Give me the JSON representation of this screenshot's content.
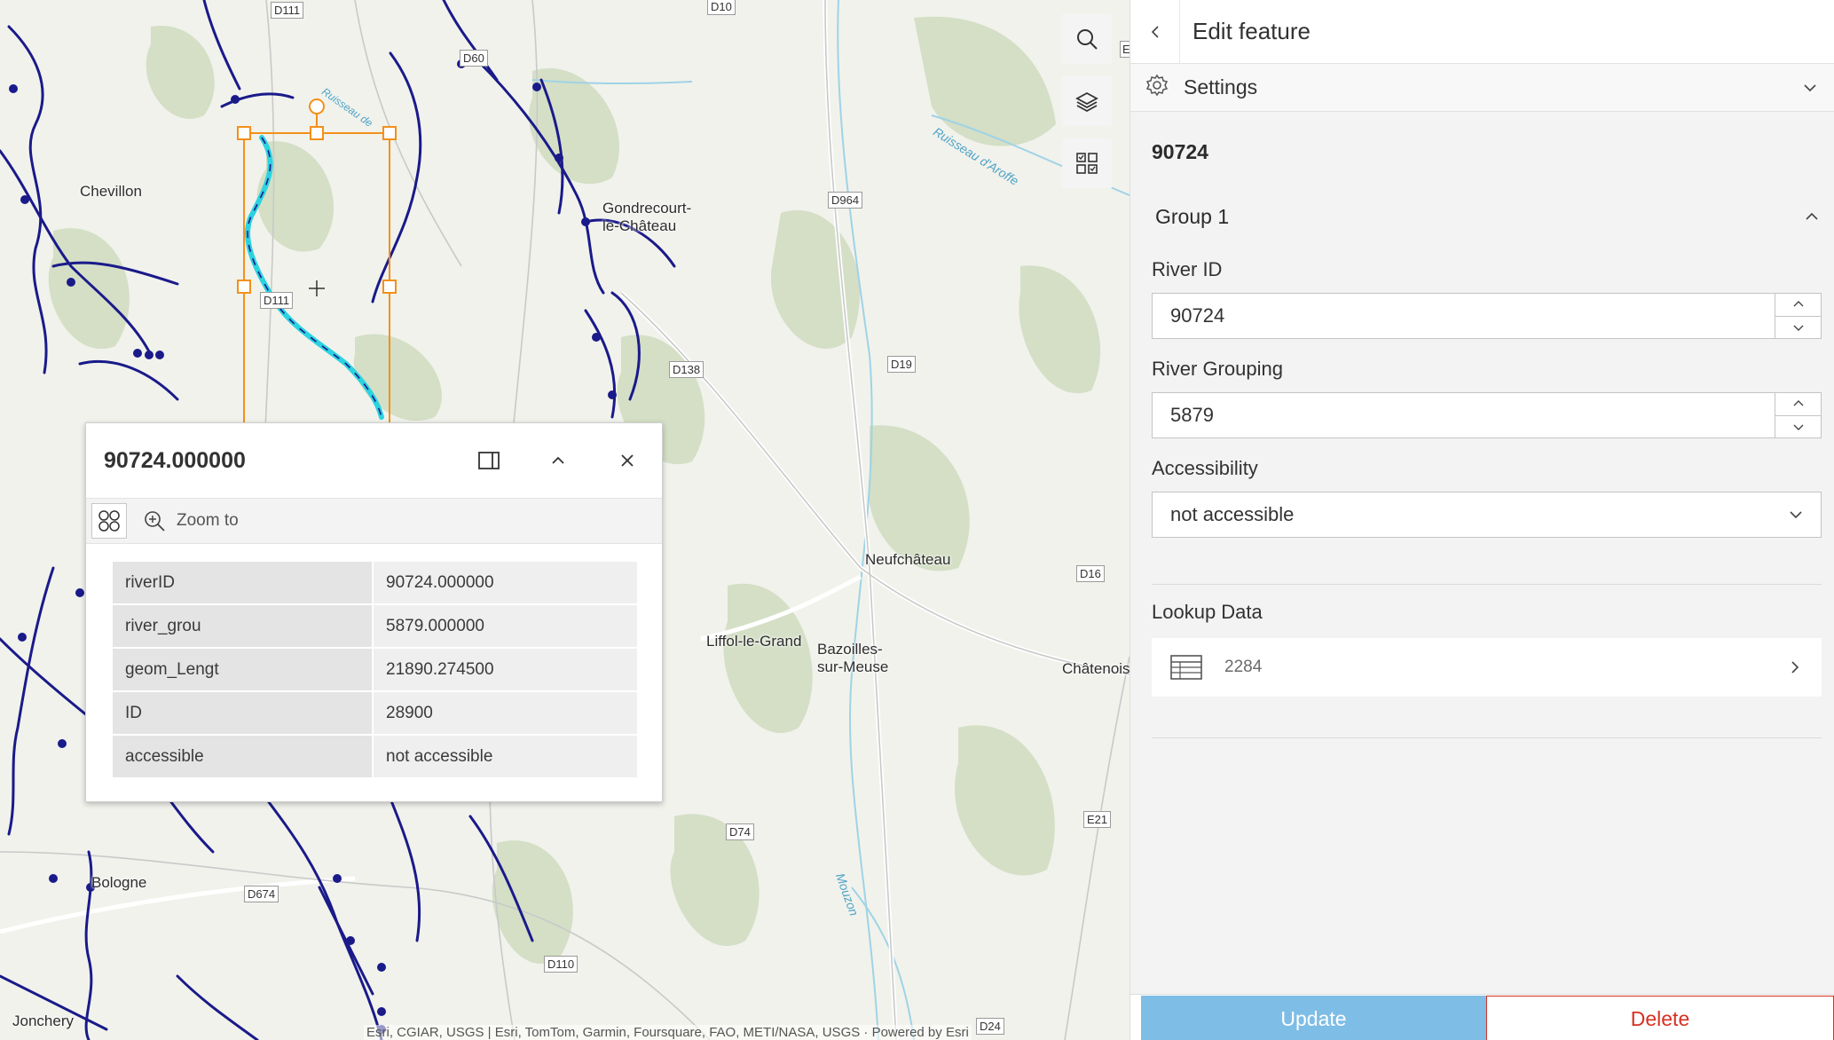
{
  "map": {
    "places": [
      "Chevillon",
      "Gondrecourt-",
      "le-Château",
      "Neufchâteau",
      "Liffol-le-Grand",
      "Bazoilles-",
      "sur-Meuse",
      "Châtenois",
      "Bologne",
      "Jonchery"
    ],
    "roads": [
      "D111",
      "D10",
      "D60",
      "D964",
      "D111",
      "D138",
      "D19",
      "D16",
      "D74",
      "D674",
      "D110",
      "D24",
      "E21",
      "E"
    ],
    "rivers": [
      "Ruisseau d'Aroffe",
      "Mouzon",
      "Ruisseau de"
    ],
    "attribution": "Esri, CGIAR, USGS | Esri, TomTom, Garmin, Foursquare, FAO, METI/NASA, USGS · Powered by Esri",
    "tools": [
      "search-icon",
      "layers-icon",
      "qr-select-icon"
    ]
  },
  "popup": {
    "title": "90724.000000",
    "zoom_label": "Zoom to",
    "rows": [
      {
        "key": "riverID",
        "value": "90724.000000"
      },
      {
        "key": "river_grou",
        "value": "5879.000000"
      },
      {
        "key": "geom_Lengt",
        "value": "21890.274500"
      },
      {
        "key": "ID",
        "value": "28900"
      },
      {
        "key": "accessible",
        "value": "not accessible"
      }
    ]
  },
  "panel": {
    "title": "Edit feature",
    "settings_label": "Settings",
    "feature_id": "90724",
    "group_title": "Group 1",
    "fields": {
      "river_id": {
        "label": "River ID",
        "value": "90724"
      },
      "river_grouping": {
        "label": "River Grouping",
        "value": "5879"
      },
      "accessibility": {
        "label": "Accessibility",
        "value": "not accessible"
      }
    },
    "lookup": {
      "label": "Lookup Data",
      "value": "2284"
    },
    "update_label": "Update",
    "delete_label": "Delete"
  },
  "colors": {
    "accent": "#7ebde6",
    "danger": "#d83020",
    "selection": "#f39019",
    "river": "#1a1a8a",
    "highlight": "#2bd3e0"
  }
}
